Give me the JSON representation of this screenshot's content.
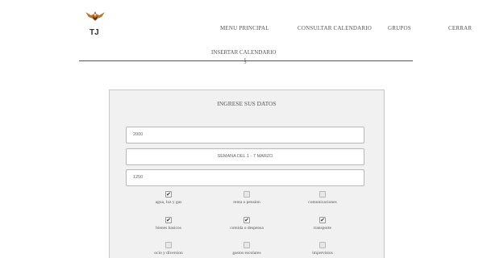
{
  "header": {
    "logo_text": "TJ",
    "nav": [
      "MENU PRINCIPAL",
      "CONSULTAR CALENDARIO",
      "GRUPOS",
      "CERRAR"
    ],
    "subtitle": "INSERTAR CALENDARIO",
    "section_mark": "§"
  },
  "form": {
    "title": "INGRESE SUS DATOS",
    "field1_value": "2000",
    "field2_value": "SEMANA DEL 1 - 7 MARZO",
    "field3_value": "1250",
    "checkboxes": [
      {
        "label": "agua, luz y gas",
        "checked": true
      },
      {
        "label": "renta o pension",
        "checked": false
      },
      {
        "label": "comunicaciones",
        "checked": false
      },
      {
        "label": "bienes basicos",
        "checked": true
      },
      {
        "label": "comida o despensa",
        "checked": true
      },
      {
        "label": "transporte",
        "checked": true
      },
      {
        "label": "ocio y diversion",
        "checked": false
      },
      {
        "label": "gastos escolares",
        "checked": false
      },
      {
        "label": "imprevistos",
        "checked": false
      }
    ]
  },
  "colors": {
    "logo_primary": "#b3772a",
    "logo_accent": "#7a2a1a",
    "panel_background": "#f1f1f1"
  }
}
